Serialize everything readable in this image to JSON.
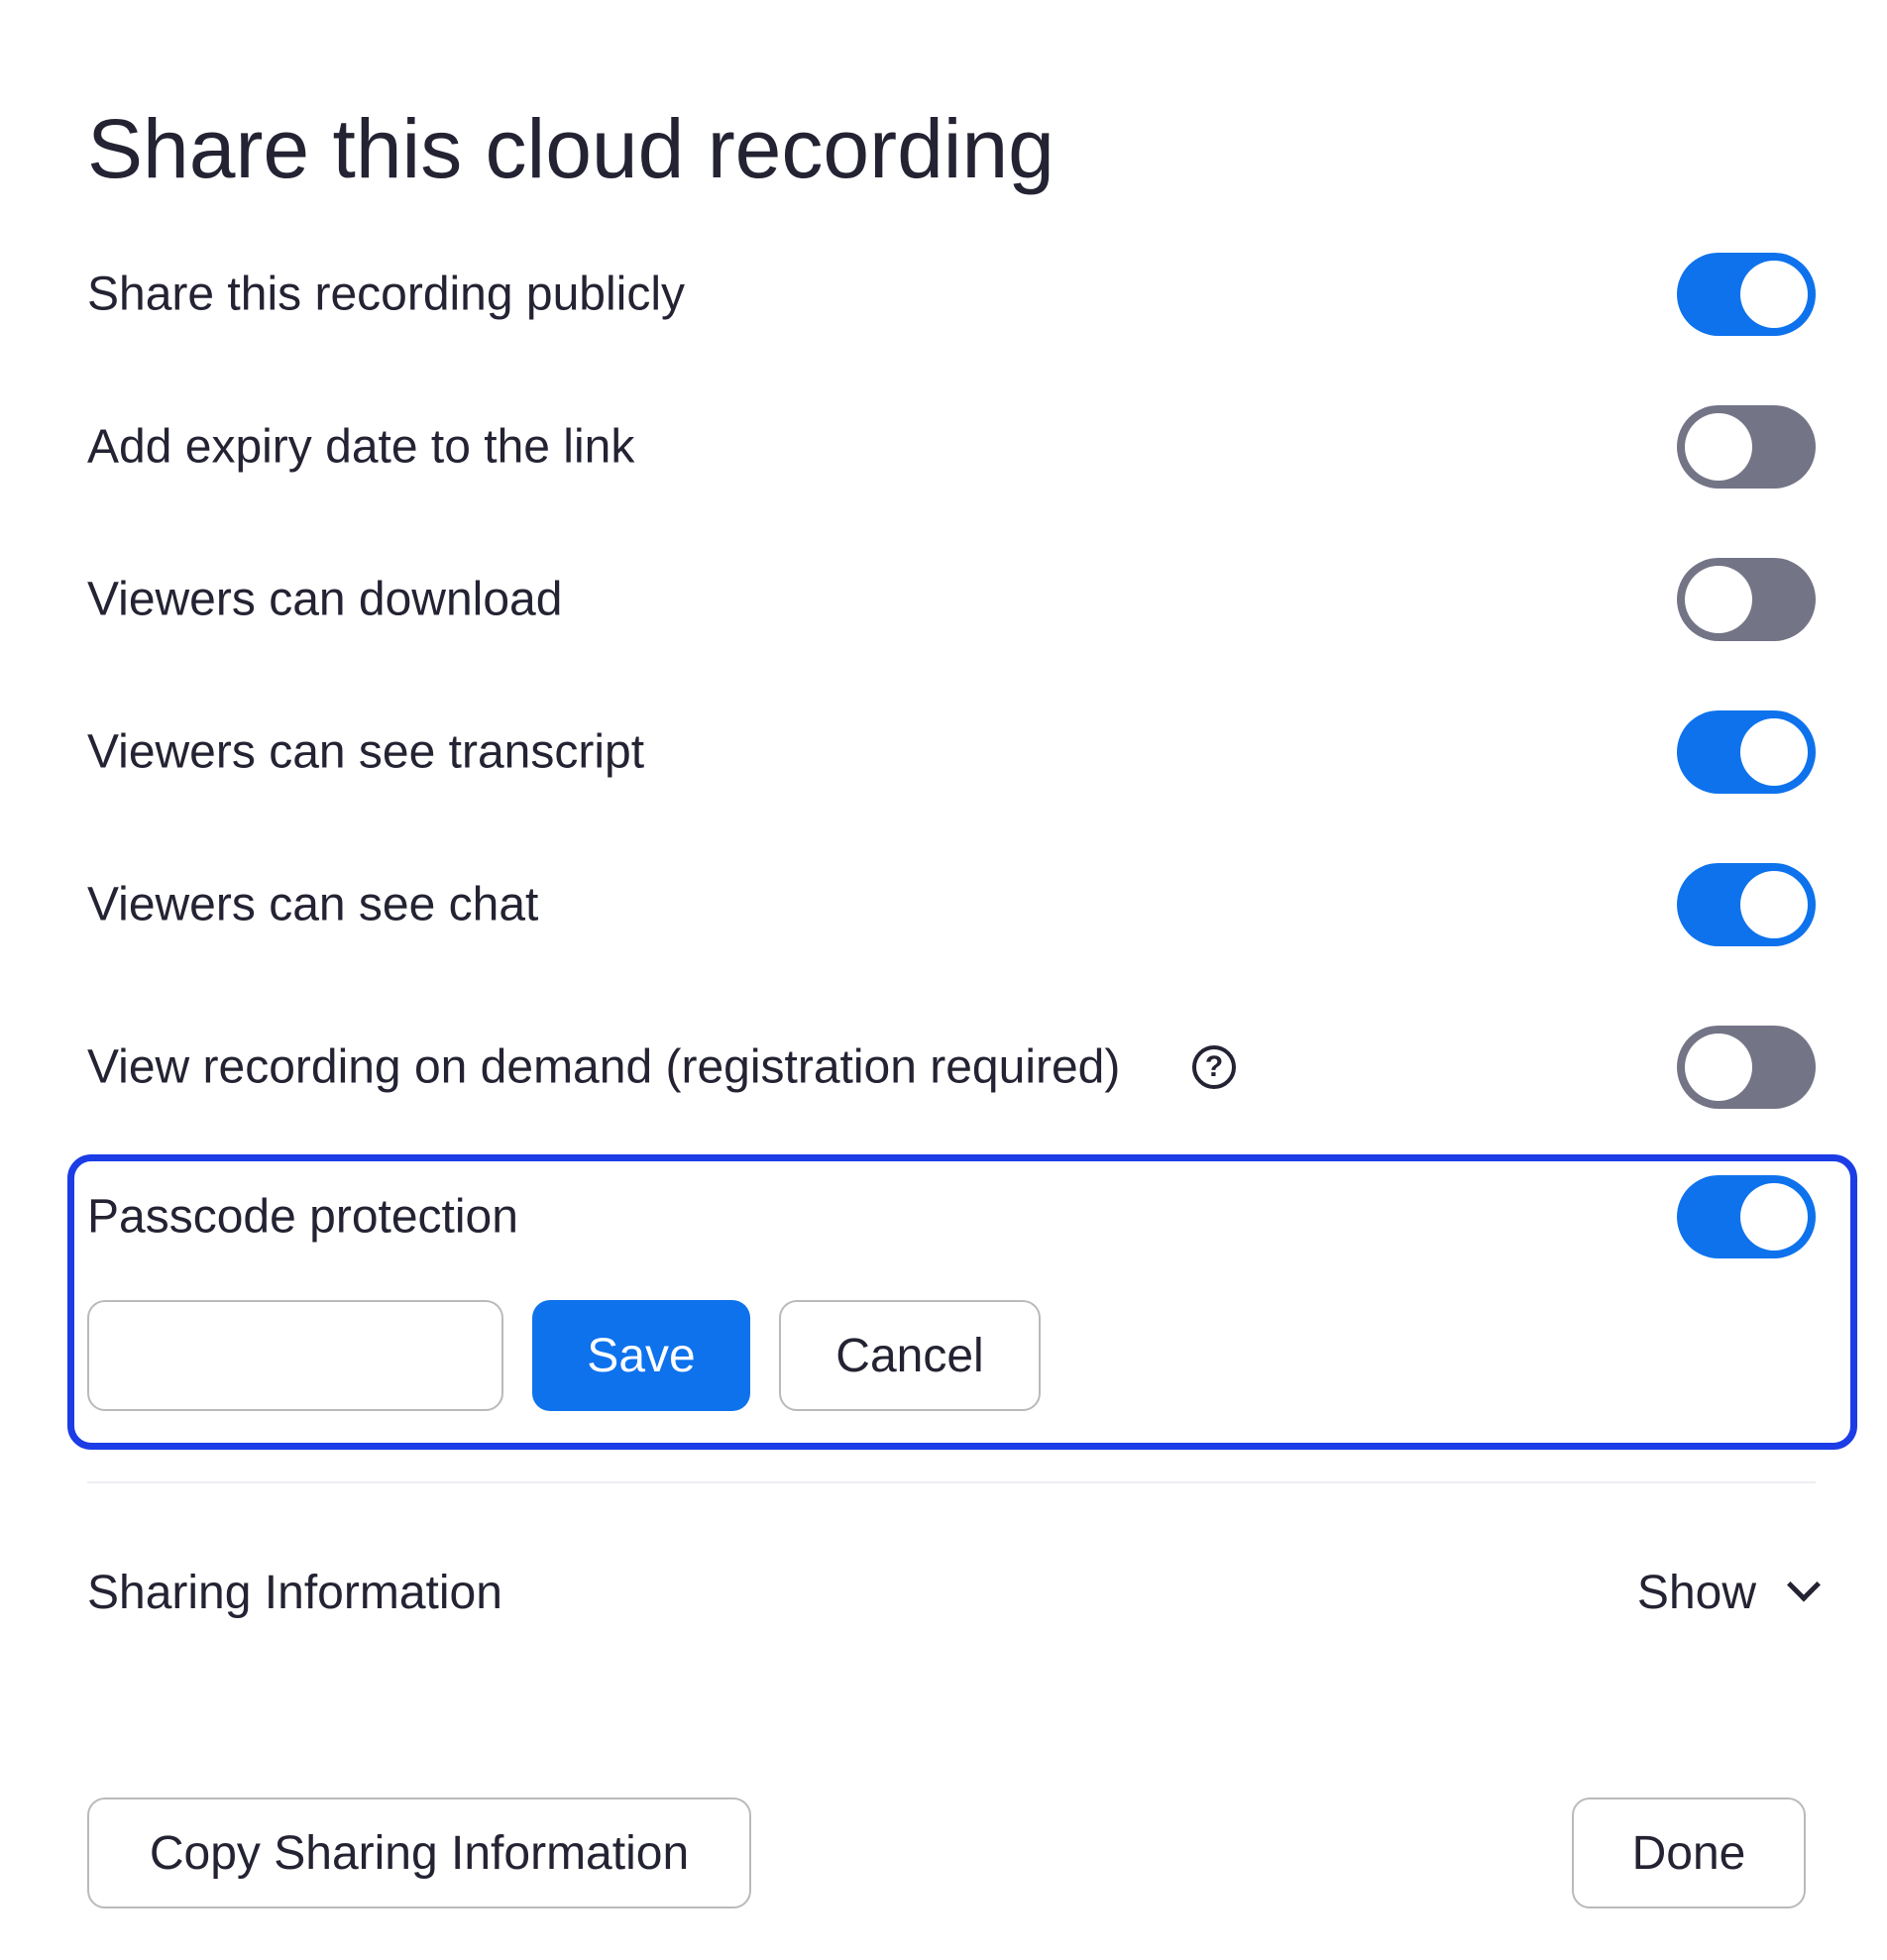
{
  "dialog": {
    "title": "Share this cloud recording"
  },
  "settings": [
    {
      "label": "Share this recording publicly",
      "enabled": true
    },
    {
      "label": "Add expiry date to the link",
      "enabled": false
    },
    {
      "label": "Viewers can download",
      "enabled": false
    },
    {
      "label": "Viewers can see transcript",
      "enabled": true
    },
    {
      "label": "Viewers can see chat",
      "enabled": true
    },
    {
      "label": "View recording on demand (registration required)",
      "enabled": false,
      "help_icon": "question-circle-icon",
      "help_glyph": "?"
    }
  ],
  "passcode": {
    "label": "Passcode protection",
    "enabled": true,
    "input_value": "",
    "save_label": "Save",
    "cancel_label": "Cancel"
  },
  "sharing_info": {
    "label": "Sharing Information",
    "toggle_label": "Show",
    "toggle_icon": "chevron-down-icon"
  },
  "footer": {
    "copy_label": "Copy Sharing Information",
    "done_label": "Done"
  },
  "colors": {
    "accent": "#0e72ed",
    "toggle_off": "#747487",
    "focus_outline": "#1c3ce6",
    "text": "#232333"
  }
}
